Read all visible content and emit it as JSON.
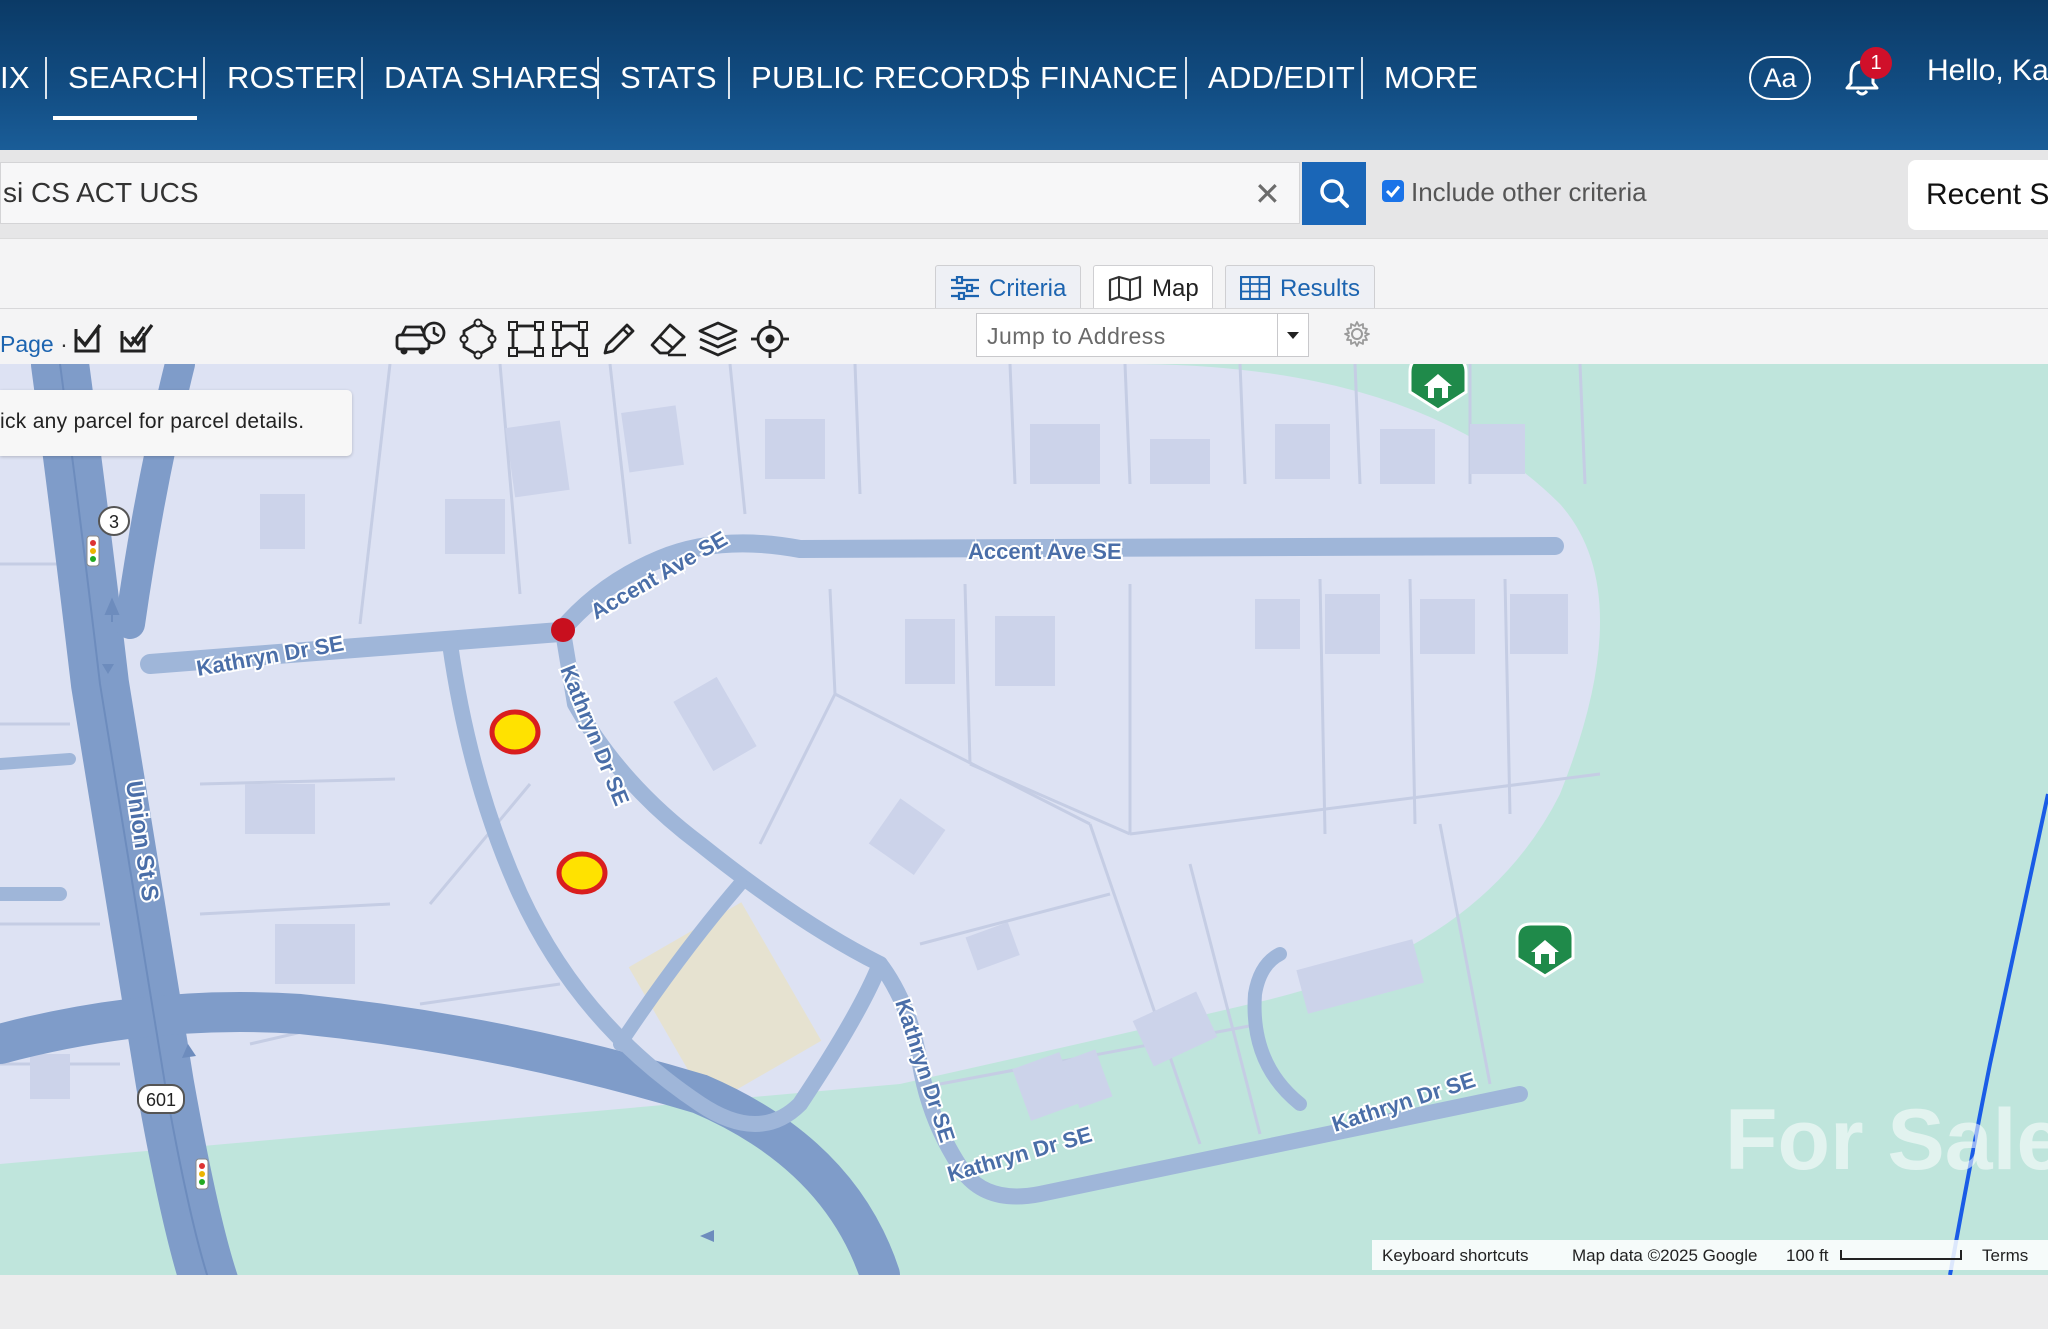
{
  "nav": {
    "partial_left": "IX",
    "items": [
      {
        "label": "SEARCH",
        "active": true
      },
      {
        "label": "ROSTER"
      },
      {
        "label": "DATA SHARES"
      },
      {
        "label": "STATS"
      },
      {
        "label": "PUBLIC RECORDS"
      },
      {
        "label": "FINANCE"
      },
      {
        "label": "ADD/EDIT"
      },
      {
        "label": "MORE"
      }
    ],
    "font_button": "Aa",
    "notification_count": "1",
    "greeting": "Hello, Ka"
  },
  "search": {
    "query": "si CS ACT UCS",
    "clear_glyph": "✕",
    "include_other_criteria": {
      "label": "Include other criteria",
      "checked": true
    },
    "recent_label": "Recent S"
  },
  "tabs": [
    {
      "label": "Criteria",
      "icon": "sliders-icon"
    },
    {
      "label": "Map",
      "icon": "map-icon",
      "active": true
    },
    {
      "label": "Results",
      "icon": "grid-icon"
    }
  ],
  "toolbar": {
    "page_link": "Page",
    "page_sep": "·",
    "tools": [
      "check-icon",
      "double-check-icon",
      "drive-time-icon",
      "polygon-icon",
      "rectangle-icon",
      "custom-shape-icon",
      "pencil-icon",
      "eraser-icon",
      "layers-icon",
      "locate-icon"
    ],
    "jump_placeholder": "Jump to Address"
  },
  "map": {
    "tooltip": "ick any parcel for parcel details.",
    "streets": {
      "accent_curve": "Accent Ave SE",
      "accent_straight": "Accent Ave SE",
      "kathryn_west": "Kathryn Dr SE",
      "kathryn_diag": "Kathryn Dr SE",
      "kathryn_south": "Kathryn Dr SE",
      "kathryn_bottom": "Kathryn Dr SE",
      "kathryn_east": "Kathryn Dr SE",
      "union": "Union St S"
    },
    "route_shields": [
      "3",
      "601"
    ],
    "attribution": {
      "shortcuts": "Keyboard shortcuts",
      "map_data": "Map data ©2025 Google",
      "scale": "100 ft",
      "terms": "Terms"
    },
    "watermark": "For Sale",
    "colors": {
      "land": "#bfe5dc",
      "parcel_area": "#dde2f3",
      "road": "#9fb6d9",
      "major_road": "#7f9cc9",
      "marker_fill": "#ffe200",
      "marker_ring": "#d91e1e",
      "house_pin": "#1f8a4a",
      "boundary": "#1a5ce6"
    }
  }
}
